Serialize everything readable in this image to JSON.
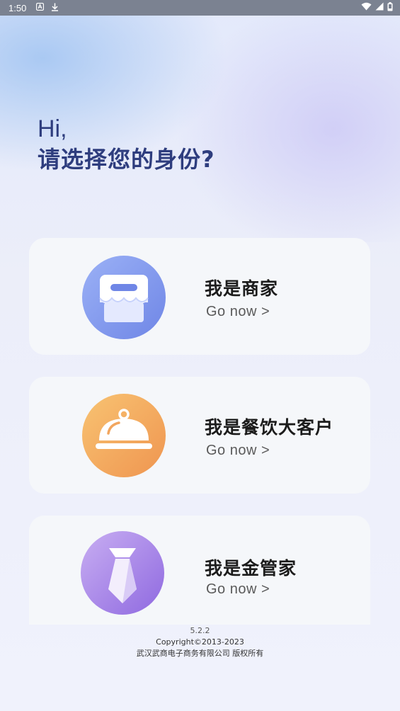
{
  "status_bar": {
    "time": "1:50",
    "left_icons": [
      "notification-a-icon",
      "download-icon"
    ],
    "right_icons": [
      "wifi-icon",
      "signal-icon",
      "battery-icon"
    ]
  },
  "greeting": {
    "hi": "Hi,",
    "question": "请选择您的身份?"
  },
  "cards": [
    {
      "title": "我是商家",
      "subtitle": "Go now >",
      "icon": "store-icon",
      "color_from": "#9bb1f6",
      "color_to": "#6f86e6"
    },
    {
      "title": "我是餐饮大客户",
      "subtitle": "Go now >",
      "icon": "cloche-icon",
      "color_from": "#f8c372",
      "color_to": "#ef9550"
    },
    {
      "title": "我是金管家",
      "subtitle": "Go now >",
      "icon": "tie-icon",
      "color_from": "#c8aef2",
      "color_to": "#8f69e0"
    }
  ],
  "footer": {
    "version": "5.2.2",
    "copyright": "Copyright©2013-2023",
    "company": "武汉武商电子商务有限公司 版权所有"
  }
}
